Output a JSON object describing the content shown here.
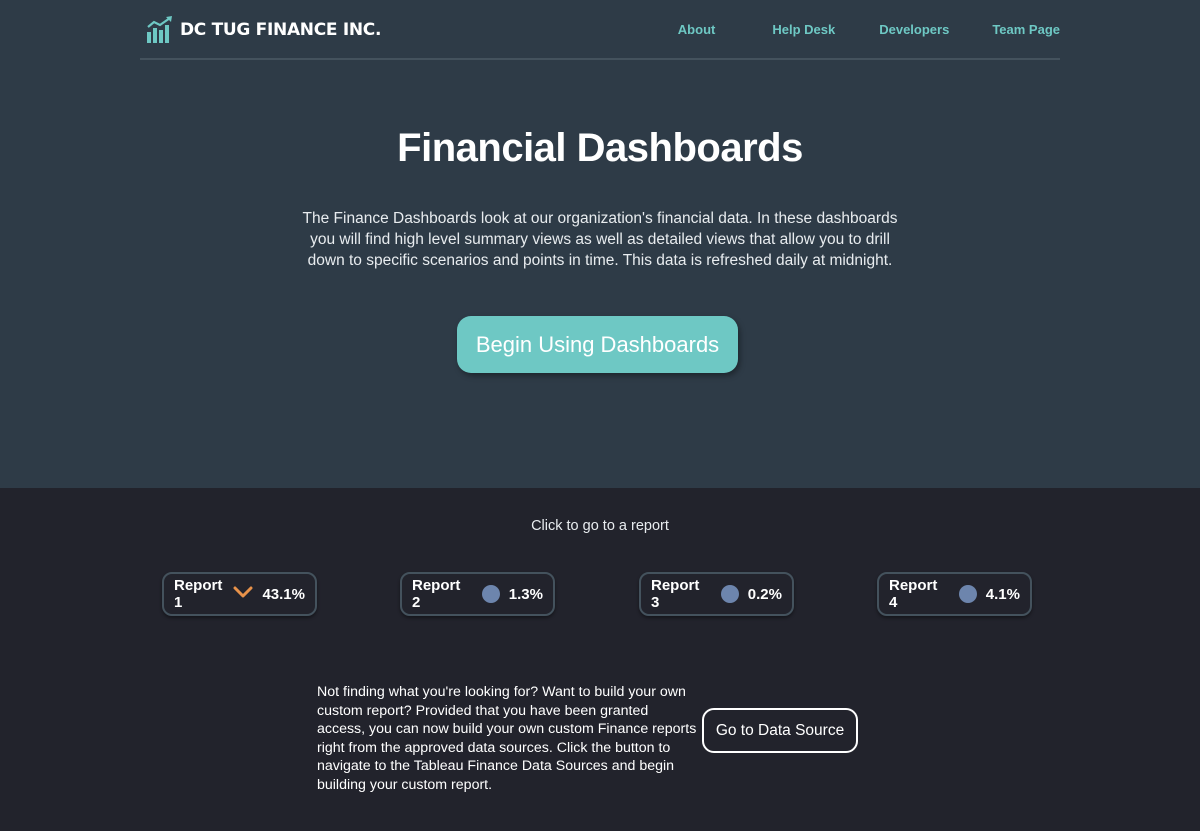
{
  "brand": {
    "name": "DC TUG FINANCE INC.",
    "logo_icon": "bar-chart-growth-icon",
    "accent_color": "#6ec8c4"
  },
  "nav": {
    "items": [
      {
        "label": "About"
      },
      {
        "label": "Help Desk"
      },
      {
        "label": "Developers"
      },
      {
        "label": "Team Page"
      }
    ]
  },
  "hero": {
    "title": "Financial Dashboards",
    "description": "The Finance Dashboards look at our organization's financial data. In these dashboards you will find high level summary views as well as detailed views that allow you to drill down to specific scenarios and points in time. This data is refreshed daily at midnight.",
    "cta_label": "Begin Using Dashboards"
  },
  "reports": {
    "hint": "Click to go to a report",
    "items": [
      {
        "label": "Report 1",
        "value": "43.1%",
        "indicator": "chevron-down-icon",
        "indicator_color": "#e8924a"
      },
      {
        "label": "Report 2",
        "value": "1.3%",
        "indicator": "neutral-dot-icon",
        "indicator_color": "#6d85ad"
      },
      {
        "label": "Report 3",
        "value": "0.2%",
        "indicator": "neutral-dot-icon",
        "indicator_color": "#6d85ad"
      },
      {
        "label": "Report 4",
        "value": "4.1%",
        "indicator": "neutral-dot-icon",
        "indicator_color": "#6d85ad"
      }
    ]
  },
  "custom": {
    "text": "Not finding what you're looking for? Want to build your own custom report? Provided that you have been granted access, you can now build your own custom Finance reports right from the approved data sources. Click the button to navigate to the Tableau Finance Data Sources and begin building your custom report.",
    "button_label": "Go to Data Source"
  }
}
